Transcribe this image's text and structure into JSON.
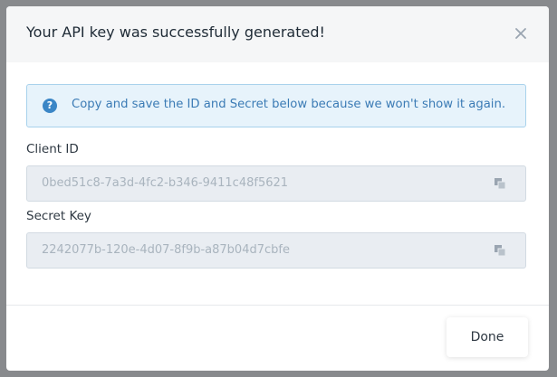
{
  "modal": {
    "title": "Your API key was successfully generated!",
    "close_icon": "close-icon"
  },
  "alert": {
    "icon": "question-circle-icon",
    "text": "Copy and save the ID and Secret below because we won't show it again."
  },
  "fields": [
    {
      "label": "Client ID",
      "value": "0bed51c8-7a3d-4fc2-b346-9411c48f5621",
      "copy_icon": "copy-icon"
    },
    {
      "label": "Secret Key",
      "value": "2242077b-120e-4d07-8f9b-a87b04d7cbfe",
      "copy_icon": "copy-icon"
    }
  ],
  "footer": {
    "done_label": "Done"
  },
  "colors": {
    "overlay": "#888a8d",
    "header_bg": "#f5f6f7",
    "alert_bg": "#e7f3fb",
    "alert_border": "#a8d2ec",
    "alert_text": "#3b7bb5",
    "alert_icon": "#3b86c6",
    "field_bg": "#e9edf2",
    "field_text": "#a9b4be"
  }
}
